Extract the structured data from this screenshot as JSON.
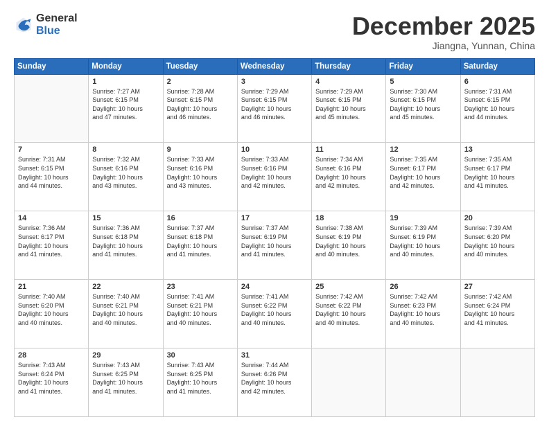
{
  "logo": {
    "general": "General",
    "blue": "Blue"
  },
  "header": {
    "month": "December 2025",
    "location": "Jiangna, Yunnan, China"
  },
  "days_of_week": [
    "Sunday",
    "Monday",
    "Tuesday",
    "Wednesday",
    "Thursday",
    "Friday",
    "Saturday"
  ],
  "weeks": [
    [
      {
        "day": "",
        "empty": true,
        "lines": []
      },
      {
        "day": "1",
        "lines": [
          "Sunrise: 7:27 AM",
          "Sunset: 6:15 PM",
          "Daylight: 10 hours",
          "and 47 minutes."
        ]
      },
      {
        "day": "2",
        "lines": [
          "Sunrise: 7:28 AM",
          "Sunset: 6:15 PM",
          "Daylight: 10 hours",
          "and 46 minutes."
        ]
      },
      {
        "day": "3",
        "lines": [
          "Sunrise: 7:29 AM",
          "Sunset: 6:15 PM",
          "Daylight: 10 hours",
          "and 46 minutes."
        ]
      },
      {
        "day": "4",
        "lines": [
          "Sunrise: 7:29 AM",
          "Sunset: 6:15 PM",
          "Daylight: 10 hours",
          "and 45 minutes."
        ]
      },
      {
        "day": "5",
        "lines": [
          "Sunrise: 7:30 AM",
          "Sunset: 6:15 PM",
          "Daylight: 10 hours",
          "and 45 minutes."
        ]
      },
      {
        "day": "6",
        "lines": [
          "Sunrise: 7:31 AM",
          "Sunset: 6:15 PM",
          "Daylight: 10 hours",
          "and 44 minutes."
        ]
      }
    ],
    [
      {
        "day": "7",
        "lines": [
          "Sunrise: 7:31 AM",
          "Sunset: 6:15 PM",
          "Daylight: 10 hours",
          "and 44 minutes."
        ]
      },
      {
        "day": "8",
        "lines": [
          "Sunrise: 7:32 AM",
          "Sunset: 6:16 PM",
          "Daylight: 10 hours",
          "and 43 minutes."
        ]
      },
      {
        "day": "9",
        "lines": [
          "Sunrise: 7:33 AM",
          "Sunset: 6:16 PM",
          "Daylight: 10 hours",
          "and 43 minutes."
        ]
      },
      {
        "day": "10",
        "lines": [
          "Sunrise: 7:33 AM",
          "Sunset: 6:16 PM",
          "Daylight: 10 hours",
          "and 42 minutes."
        ]
      },
      {
        "day": "11",
        "lines": [
          "Sunrise: 7:34 AM",
          "Sunset: 6:16 PM",
          "Daylight: 10 hours",
          "and 42 minutes."
        ]
      },
      {
        "day": "12",
        "lines": [
          "Sunrise: 7:35 AM",
          "Sunset: 6:17 PM",
          "Daylight: 10 hours",
          "and 42 minutes."
        ]
      },
      {
        "day": "13",
        "lines": [
          "Sunrise: 7:35 AM",
          "Sunset: 6:17 PM",
          "Daylight: 10 hours",
          "and 41 minutes."
        ]
      }
    ],
    [
      {
        "day": "14",
        "lines": [
          "Sunrise: 7:36 AM",
          "Sunset: 6:17 PM",
          "Daylight: 10 hours",
          "and 41 minutes."
        ]
      },
      {
        "day": "15",
        "lines": [
          "Sunrise: 7:36 AM",
          "Sunset: 6:18 PM",
          "Daylight: 10 hours",
          "and 41 minutes."
        ]
      },
      {
        "day": "16",
        "lines": [
          "Sunrise: 7:37 AM",
          "Sunset: 6:18 PM",
          "Daylight: 10 hours",
          "and 41 minutes."
        ]
      },
      {
        "day": "17",
        "lines": [
          "Sunrise: 7:37 AM",
          "Sunset: 6:19 PM",
          "Daylight: 10 hours",
          "and 41 minutes."
        ]
      },
      {
        "day": "18",
        "lines": [
          "Sunrise: 7:38 AM",
          "Sunset: 6:19 PM",
          "Daylight: 10 hours",
          "and 40 minutes."
        ]
      },
      {
        "day": "19",
        "lines": [
          "Sunrise: 7:39 AM",
          "Sunset: 6:19 PM",
          "Daylight: 10 hours",
          "and 40 minutes."
        ]
      },
      {
        "day": "20",
        "lines": [
          "Sunrise: 7:39 AM",
          "Sunset: 6:20 PM",
          "Daylight: 10 hours",
          "and 40 minutes."
        ]
      }
    ],
    [
      {
        "day": "21",
        "lines": [
          "Sunrise: 7:40 AM",
          "Sunset: 6:20 PM",
          "Daylight: 10 hours",
          "and 40 minutes."
        ]
      },
      {
        "day": "22",
        "lines": [
          "Sunrise: 7:40 AM",
          "Sunset: 6:21 PM",
          "Daylight: 10 hours",
          "and 40 minutes."
        ]
      },
      {
        "day": "23",
        "lines": [
          "Sunrise: 7:41 AM",
          "Sunset: 6:21 PM",
          "Daylight: 10 hours",
          "and 40 minutes."
        ]
      },
      {
        "day": "24",
        "lines": [
          "Sunrise: 7:41 AM",
          "Sunset: 6:22 PM",
          "Daylight: 10 hours",
          "and 40 minutes."
        ]
      },
      {
        "day": "25",
        "lines": [
          "Sunrise: 7:42 AM",
          "Sunset: 6:22 PM",
          "Daylight: 10 hours",
          "and 40 minutes."
        ]
      },
      {
        "day": "26",
        "lines": [
          "Sunrise: 7:42 AM",
          "Sunset: 6:23 PM",
          "Daylight: 10 hours",
          "and 40 minutes."
        ]
      },
      {
        "day": "27",
        "lines": [
          "Sunrise: 7:42 AM",
          "Sunset: 6:24 PM",
          "Daylight: 10 hours",
          "and 41 minutes."
        ]
      }
    ],
    [
      {
        "day": "28",
        "lines": [
          "Sunrise: 7:43 AM",
          "Sunset: 6:24 PM",
          "Daylight: 10 hours",
          "and 41 minutes."
        ]
      },
      {
        "day": "29",
        "lines": [
          "Sunrise: 7:43 AM",
          "Sunset: 6:25 PM",
          "Daylight: 10 hours",
          "and 41 minutes."
        ]
      },
      {
        "day": "30",
        "lines": [
          "Sunrise: 7:43 AM",
          "Sunset: 6:25 PM",
          "Daylight: 10 hours",
          "and 41 minutes."
        ]
      },
      {
        "day": "31",
        "lines": [
          "Sunrise: 7:44 AM",
          "Sunset: 6:26 PM",
          "Daylight: 10 hours",
          "and 42 minutes."
        ]
      },
      {
        "day": "",
        "empty": true,
        "lines": []
      },
      {
        "day": "",
        "empty": true,
        "lines": []
      },
      {
        "day": "",
        "empty": true,
        "lines": []
      }
    ]
  ]
}
